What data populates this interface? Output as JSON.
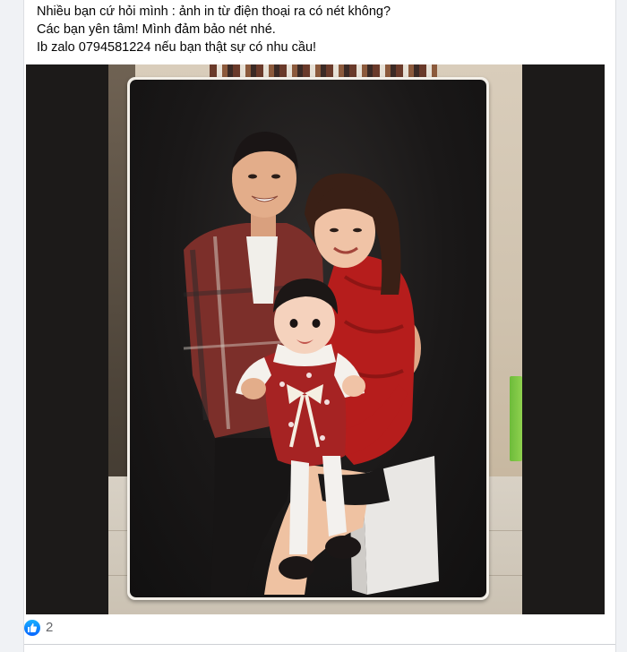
{
  "post": {
    "text_lines": [
      "Nhiều bạn cứ hỏi mình : ảnh in từ điện thoại ra có nét không?",
      "Các bạn yên tâm! Mình đảm bảo nét nhé.",
      "Ib zalo 0794581224 nếu bạn thật sự có nhu cầu!"
    ]
  },
  "media": {
    "icon": "photo-print-board"
  },
  "reactions": {
    "icon": "like-icon",
    "count": "2",
    "color": "#0866ff"
  }
}
